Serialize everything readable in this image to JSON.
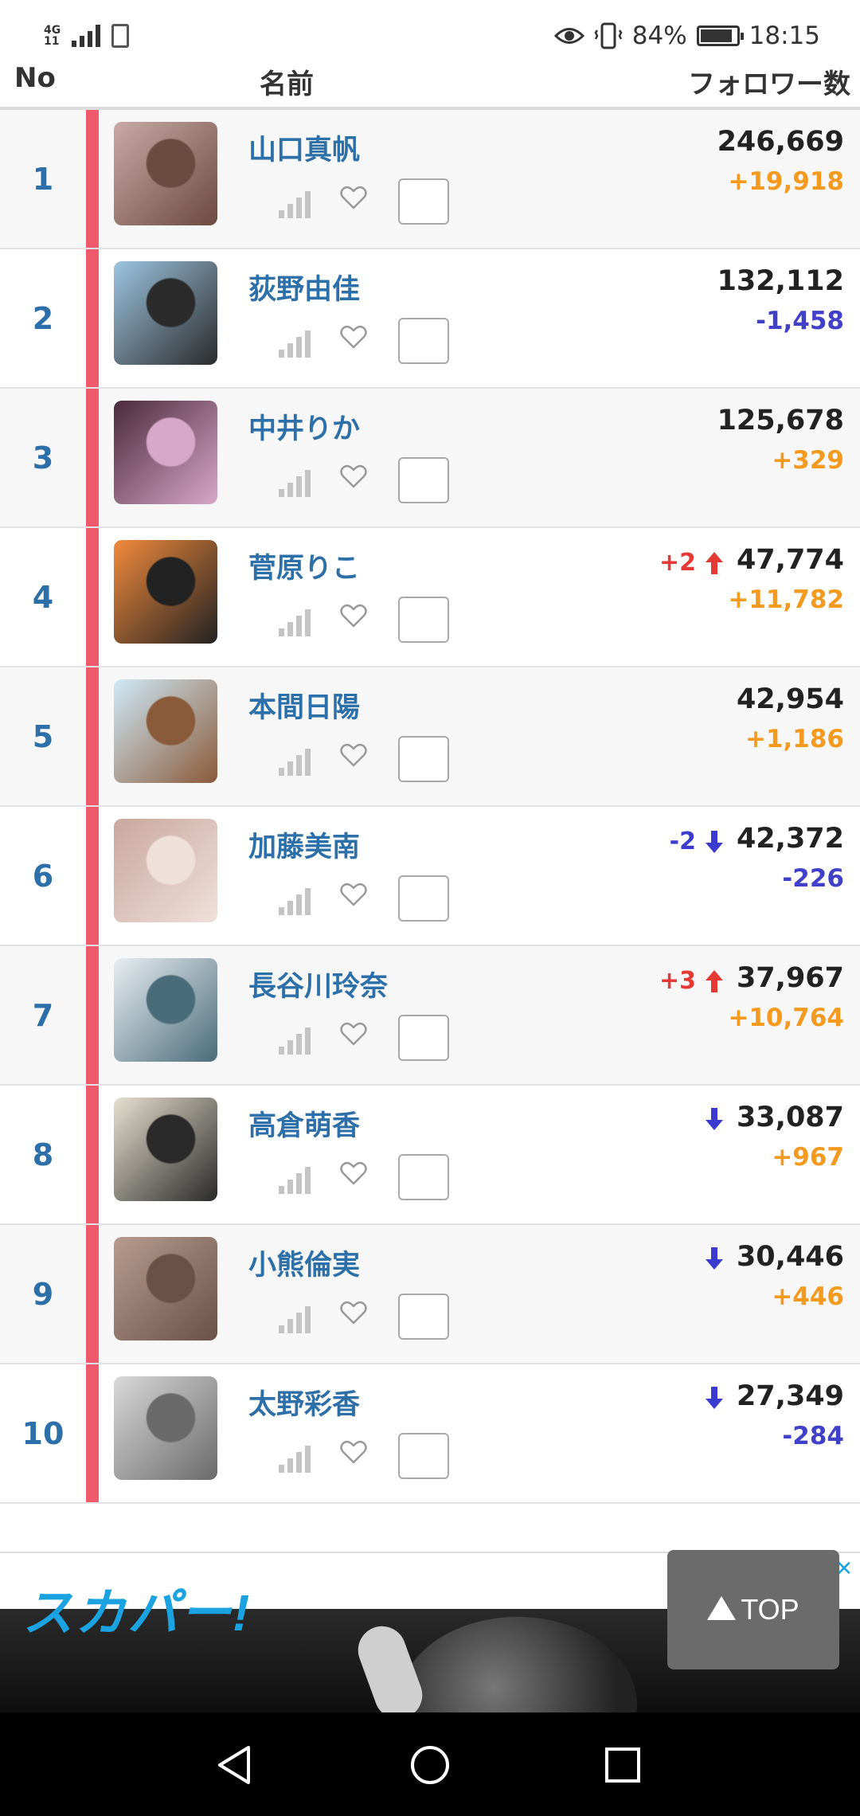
{
  "statusbar": {
    "network": "4G",
    "network_sub": "11",
    "battery": "84%",
    "time": "18:15"
  },
  "table_header": {
    "no": "No",
    "name": "名前",
    "followers": "フォロワー数"
  },
  "rows": [
    {
      "rank": "1",
      "name": "山口真帆",
      "followers": "246,669",
      "delta": "+19,918",
      "delta_sign": "plus",
      "rank_change": "",
      "rank_dir": ""
    },
    {
      "rank": "2",
      "name": "荻野由佳",
      "followers": "132,112",
      "delta": "-1,458",
      "delta_sign": "minus",
      "rank_change": "",
      "rank_dir": ""
    },
    {
      "rank": "3",
      "name": "中井りか",
      "followers": "125,678",
      "delta": "+329",
      "delta_sign": "plus",
      "rank_change": "",
      "rank_dir": ""
    },
    {
      "rank": "4",
      "name": "菅原りこ",
      "followers": "47,774",
      "delta": "+11,782",
      "delta_sign": "plus",
      "rank_change": "+2",
      "rank_dir": "up"
    },
    {
      "rank": "5",
      "name": "本間日陽",
      "followers": "42,954",
      "delta": "+1,186",
      "delta_sign": "plus",
      "rank_change": "",
      "rank_dir": ""
    },
    {
      "rank": "6",
      "name": "加藤美南",
      "followers": "42,372",
      "delta": "-226",
      "delta_sign": "minus",
      "rank_change": "-2",
      "rank_dir": "down"
    },
    {
      "rank": "7",
      "name": "長谷川玲奈",
      "followers": "37,967",
      "delta": "+10,764",
      "delta_sign": "plus",
      "rank_change": "+3",
      "rank_dir": "up"
    },
    {
      "rank": "8",
      "name": "高倉萌香",
      "followers": "33,087",
      "delta": "+967",
      "delta_sign": "plus",
      "rank_change": "",
      "rank_dir": "down"
    },
    {
      "rank": "9",
      "name": "小熊倫実",
      "followers": "30,446",
      "delta": "+446",
      "delta_sign": "plus",
      "rank_change": "",
      "rank_dir": "down"
    },
    {
      "rank": "10",
      "name": "太野彩香",
      "followers": "27,349",
      "delta": "-284",
      "delta_sign": "minus",
      "rank_change": "",
      "rank_dir": "down"
    }
  ],
  "ad": {
    "logo": "スカパー!",
    "close": "✕"
  },
  "top_button": {
    "label": "TOP"
  },
  "colors": {
    "accent_blue": "#2d6fa8",
    "rank_bar": "#ee5a6b",
    "plus": "#f39a1f",
    "minus": "#4040c8",
    "up": "#e53935",
    "down": "#3b3bd0"
  }
}
